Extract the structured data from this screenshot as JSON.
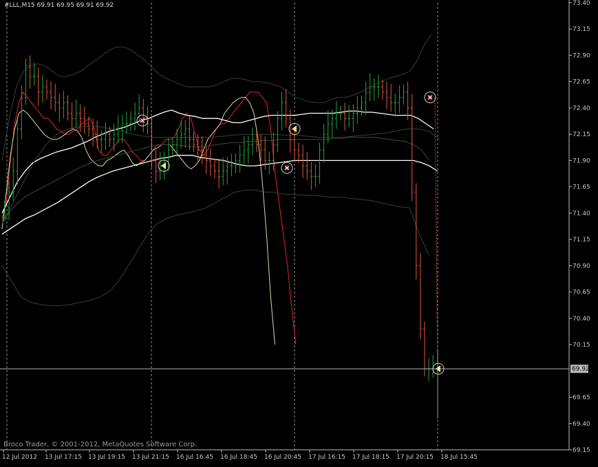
{
  "header": {
    "symbol": "#LLL,M15",
    "ohlc": "69.91 69.95 69.91 69.92"
  },
  "copyright": "Broco Trader, © 2001-2012, MetaQuotes Software Corp.",
  "colors": {
    "background": "#000000",
    "axis": "#c0c0c0",
    "grid": "#c0c0c0",
    "bull_bar": "#26a63a",
    "bear_bar": "#e05a3a",
    "ma_fast": "#e02828",
    "ma_slow": "#d8dca0",
    "ma_white": "#ffffff",
    "envelope": "#3a4a3a",
    "crosshair": "#aeb6c6",
    "signal_marker": "#cccccc"
  },
  "chart_data": {
    "type": "line",
    "y_ticks": [
      "73.40",
      "73.15",
      "72.90",
      "72.65",
      "72.40",
      "72.15",
      "71.90",
      "71.65",
      "71.40",
      "71.15",
      "70.90",
      "70.65",
      "70.40",
      "70.15",
      "69.92",
      "69.65",
      "69.40",
      "69.15"
    ],
    "x_ticks": [
      "12 Jul 2012",
      "13 Jul 17:15",
      "13 Jul 19:15",
      "13 Jul 21:15",
      "16 Jul 16:45",
      "16 Jul 18:45",
      "16 Jul 20:45",
      "17 Jul 16:15",
      "17 Jul 18:15",
      "17 Jul 20:15",
      "18 Jul 15:45"
    ],
    "ylim": [
      69.15,
      73.4
    ],
    "current_price": 69.92,
    "session_separators": [
      "12 Jul 2012",
      "13 Jul 21:15",
      "16 Jul 20:45",
      "17 Jul 20:15"
    ],
    "num_bars": 104,
    "bars_close": [
      71.45,
      71.6,
      71.8,
      72.2,
      72.5,
      72.8,
      72.7,
      72.7,
      72.55,
      72.6,
      72.55,
      72.5,
      72.45,
      72.4,
      72.45,
      72.35,
      72.3,
      72.35,
      72.3,
      72.25,
      72.2,
      72.15,
      72.1,
      72.1,
      72.15,
      72.1,
      72.15,
      72.2,
      72.25,
      72.25,
      72.3,
      72.35,
      72.4,
      72.3,
      72.25,
      71.9,
      71.8,
      71.85,
      71.9,
      72.0,
      72.05,
      72.1,
      72.15,
      72.2,
      72.1,
      72.05,
      72.0,
      71.95,
      71.9,
      71.85,
      71.8,
      71.75,
      71.8,
      71.85,
      71.85,
      71.9,
      71.95,
      72.0,
      72.05,
      72.1,
      72.05,
      72.0,
      71.9,
      71.9,
      72.05,
      72.3,
      72.45,
      72.3,
      72.1,
      72.0,
      71.95,
      71.85,
      71.8,
      71.75,
      71.75,
      72.0,
      72.15,
      72.25,
      72.3,
      72.35,
      72.35,
      72.3,
      72.3,
      72.35,
      72.4,
      72.45,
      72.55,
      72.6,
      72.6,
      72.6,
      72.55,
      72.5,
      72.45,
      72.45,
      72.5,
      72.55,
      72.4,
      71.6,
      70.9,
      70.3,
      69.92,
      69.92,
      69.92,
      69.92
    ],
    "series": [
      {
        "values": [
          71.35,
          71.5,
          71.9,
          72.25,
          72.45,
          72.55,
          72.5,
          72.45,
          72.4,
          72.35,
          72.3,
          72.3,
          72.25,
          72.2,
          72.18,
          72.15,
          72.15,
          72.18,
          72.2,
          72.25,
          72.28,
          72.3,
          72.2,
          72.0,
          71.95,
          71.95,
          72.0,
          72.05,
          72.1,
          72.1,
          72.05,
          71.98,
          71.95,
          71.9,
          71.9,
          71.95,
          72.0,
          72.05,
          72.05,
          72.1,
          72.1,
          72.12,
          72.2,
          72.3,
          72.35,
          72.3,
          72.15,
          72.0,
          71.95,
          72.0,
          72.1,
          72.2,
          72.25,
          72.25,
          72.3,
          72.35,
          72.4,
          72.45,
          72.5,
          72.55,
          72.55,
          72.55,
          72.5,
          72.45,
          72.2,
          71.8,
          71.5,
          71.2,
          70.9,
          70.5,
          70.15
        ]
      },
      {
        "values": [
          71.25,
          71.6,
          71.95,
          72.2,
          72.35,
          72.38,
          72.35,
          72.3,
          72.25,
          72.2,
          72.15,
          72.12,
          72.1,
          72.1,
          72.12,
          72.15,
          72.18,
          72.2,
          72.18,
          72.12,
          72.0,
          71.92,
          71.88,
          71.85,
          71.85,
          71.9,
          71.92,
          71.95,
          71.98,
          72.0,
          71.95,
          71.88,
          71.85,
          71.88,
          71.9,
          71.95,
          72.0,
          72.02,
          72.05,
          72.05,
          72.05,
          72.0,
          71.95,
          71.9,
          71.85,
          71.82,
          71.85,
          71.9,
          72.0,
          72.1,
          72.15,
          72.2,
          72.25,
          72.35,
          72.4,
          72.45,
          72.48,
          72.5,
          72.5,
          72.45,
          72.35,
          72.1,
          71.7,
          71.2,
          70.6,
          70.15
        ]
      },
      {
        "values": [
          71.4,
          71.55,
          71.7,
          71.8,
          71.88,
          71.92,
          71.95,
          71.98,
          72.0,
          72.02,
          72.05,
          72.08,
          72.12,
          72.15,
          72.18,
          72.2,
          72.22,
          72.25,
          72.28,
          72.3,
          72.33,
          72.36,
          72.38,
          72.35,
          72.33,
          72.32,
          72.3,
          72.3,
          72.3,
          72.28,
          72.26,
          72.26,
          72.28,
          72.3,
          72.32,
          72.33,
          72.33,
          72.33,
          72.33,
          72.34,
          72.35,
          72.35,
          72.35,
          72.35,
          72.36,
          72.37,
          72.37,
          72.36,
          72.36,
          72.35,
          72.34,
          72.33,
          72.33,
          72.33,
          72.3,
          72.25,
          72.2
        ]
      },
      {
        "values": [
          71.3,
          71.42,
          71.5,
          71.56,
          71.6,
          71.64,
          71.68,
          71.72,
          71.76,
          71.8,
          71.84,
          71.87,
          71.9,
          71.92,
          71.94,
          71.96,
          71.98,
          72.0,
          72.02,
          72.04,
          72.05,
          72.05,
          72.05,
          72.04,
          72.03,
          72.03,
          72.04,
          72.05,
          72.06,
          72.07,
          72.07,
          72.08,
          72.08,
          72.09,
          72.09,
          72.1,
          72.1,
          72.1,
          72.1,
          72.1,
          72.1,
          72.1,
          72.11,
          72.11,
          72.12,
          72.12,
          72.12,
          72.12,
          72.11,
          72.1,
          72.09,
          72.08,
          72.05,
          72.0,
          71.9
        ]
      },
      {
        "values": [
          71.2,
          71.25,
          71.3,
          71.35,
          71.38,
          71.42,
          71.46,
          71.5,
          71.55,
          71.6,
          71.65,
          71.7,
          71.74,
          71.77,
          71.8,
          71.82,
          71.84,
          71.86,
          71.88,
          71.9,
          71.92,
          71.93,
          71.95,
          71.95,
          71.95,
          71.93,
          71.92,
          71.91,
          71.9,
          71.88,
          71.86,
          71.85,
          71.85,
          71.86,
          71.87,
          71.88,
          71.89,
          71.9,
          71.9,
          71.9,
          71.9,
          71.9,
          71.9,
          71.9,
          71.9,
          71.9,
          71.9,
          71.9,
          71.9,
          71.9,
          71.9,
          71.9,
          71.9,
          71.88,
          71.85,
          71.8
        ]
      },
      {
        "values": [
          71.9,
          72.3,
          72.6,
          72.75,
          72.8,
          72.82,
          72.8,
          72.75,
          72.7,
          72.7,
          72.72,
          72.75,
          72.8,
          72.85,
          72.9,
          72.95,
          72.98,
          72.98,
          72.95,
          72.9,
          72.85,
          72.78,
          72.72,
          72.68,
          72.65,
          72.62,
          72.6,
          72.6,
          72.6,
          72.6,
          72.62,
          72.65,
          72.68,
          72.68,
          72.67,
          72.65,
          72.65,
          72.64,
          72.62,
          72.6,
          72.55,
          72.5,
          72.48,
          72.46,
          72.45,
          72.45,
          72.48,
          72.5,
          72.5,
          72.52,
          72.55,
          72.58,
          72.62,
          72.65,
          72.68,
          72.7,
          72.72,
          72.75,
          72.85,
          73.0,
          73.1
        ]
      },
      {
        "values": [
          70.9,
          70.75,
          70.6,
          70.55,
          70.53,
          70.52,
          70.52,
          70.53,
          70.55,
          70.57,
          70.6,
          70.65,
          70.75,
          70.9,
          71.05,
          71.2,
          71.3,
          71.35,
          71.38,
          71.4,
          71.42,
          71.45,
          71.5,
          71.55,
          71.6,
          71.62,
          71.62,
          71.6,
          71.6,
          71.58,
          71.58,
          71.57,
          71.57,
          71.56,
          71.55,
          71.55,
          71.54,
          71.53,
          71.52,
          71.5,
          71.48,
          71.46,
          71.45,
          71.2,
          71.0
        ]
      },
      {
        "values": [
          71.3,
          71.5,
          71.7,
          71.9,
          72.05,
          72.15,
          72.2,
          72.22,
          72.23,
          72.22,
          72.2,
          72.18,
          72.15,
          72.13,
          72.12,
          72.12,
          72.12,
          72.12,
          72.12,
          72.12,
          72.13,
          72.14,
          72.15,
          72.15,
          72.15,
          72.15,
          72.14,
          72.14,
          72.13,
          72.12,
          72.12,
          72.12,
          72.13,
          72.14,
          72.15,
          72.16,
          72.18,
          72.2,
          72.2,
          72.18,
          72.1
        ]
      }
    ],
    "signals": [
      {
        "bar": 29,
        "price": 72.28,
        "kind": "sell"
      },
      {
        "bar": 33,
        "price": 71.85,
        "kind": "buy"
      },
      {
        "bar": 59,
        "price": 72.2,
        "kind": "buy"
      },
      {
        "bar": 59,
        "price": 71.83,
        "kind": "sell"
      },
      {
        "bar": 89,
        "price": 72.5,
        "kind": "sell"
      },
      {
        "bar": 91,
        "price": 69.92,
        "kind": "buy"
      }
    ]
  }
}
